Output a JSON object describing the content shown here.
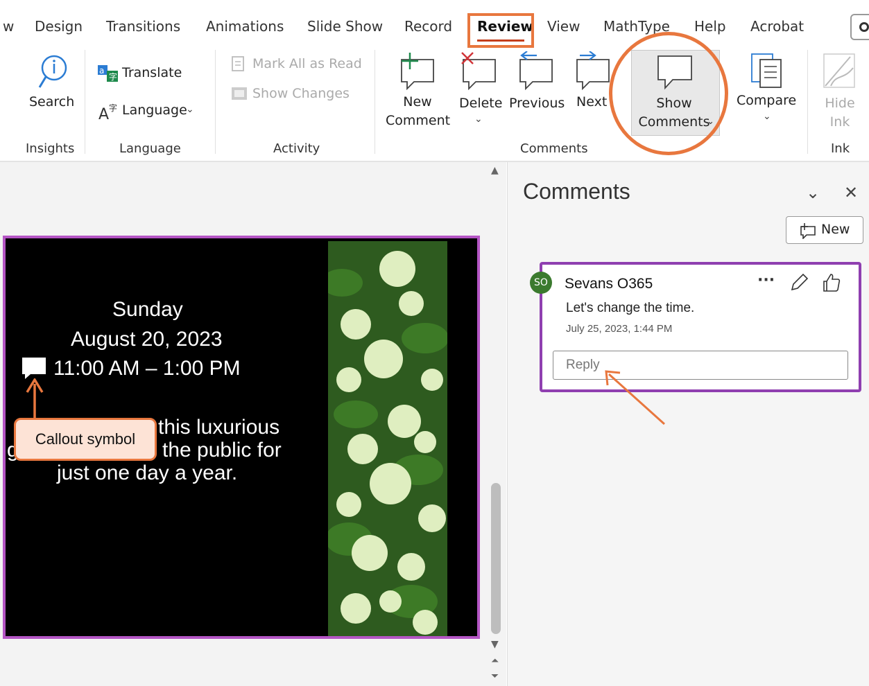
{
  "tabs": [
    "w",
    "Design",
    "Transitions",
    "Animations",
    "Slide Show",
    "Record",
    "Review",
    "View",
    "MathType",
    "Help",
    "Acrobat"
  ],
  "ribbon": {
    "search": "Search",
    "translate": "Translate",
    "language": "Language",
    "mark_all_read": "Mark All as Read",
    "show_changes": "Show Changes",
    "new_comment_1": "New",
    "new_comment_2": "Comment",
    "delete": "Delete",
    "previous": "Previous",
    "next": "Next",
    "show_comments_1": "Show",
    "show_comments_2": "Comments",
    "compare": "Compare",
    "hide_ink_1": "Hide",
    "hide_ink_2": "Ink",
    "groups": {
      "insights": "Insights",
      "language": "Language",
      "activity": "Activity",
      "comments": "Comments",
      "ink": "Ink"
    }
  },
  "slide": {
    "day": "Sunday",
    "date": "August 20, 2023",
    "time": "11:00 AM – 1:00 PM",
    "line1": "this luxurious",
    "line2_left": "g",
    "line2": "the public for",
    "line3": "just one day a year."
  },
  "annotation": {
    "callout_label": "Callout symbol"
  },
  "comments_pane": {
    "title": "Comments",
    "new_button": "New",
    "comment": {
      "initials": "SO",
      "author": "Sevans O365",
      "text": "Let's change the time.",
      "timestamp": "July 25, 2023, 1:44 PM",
      "reply_placeholder": "Reply"
    }
  },
  "colors": {
    "highlight_orange": "#e8773e",
    "slide_border": "#b455c4",
    "card_border": "#8f3fb0",
    "avatar": "#3b7a2e"
  }
}
